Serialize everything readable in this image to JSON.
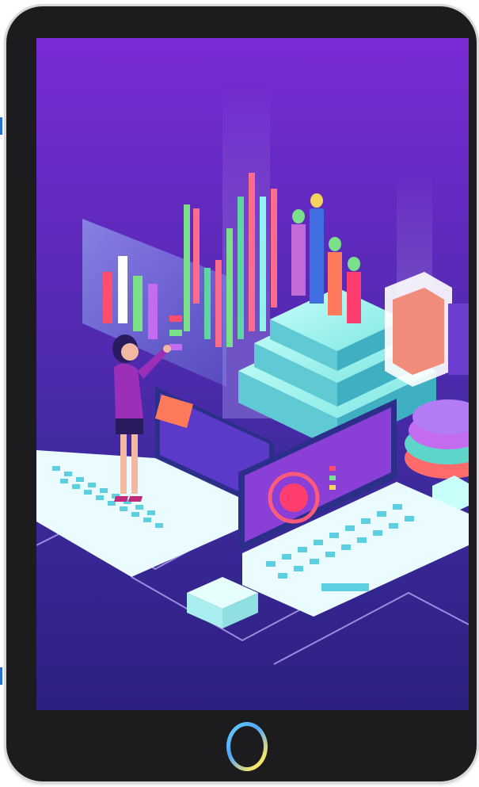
{
  "device": {
    "type": "tablet"
  },
  "illustration": {
    "theme": "isometric data analytics",
    "colors": {
      "bg_top": "#7a2bd6",
      "bg_bottom": "#2c2080",
      "cyan": "#8ff3ee",
      "laptop_screen": "#7c3fd1",
      "accent_red": "#ff4d6d",
      "accent_green": "#7be08a",
      "accent_yellow": "#f4d35e"
    }
  }
}
